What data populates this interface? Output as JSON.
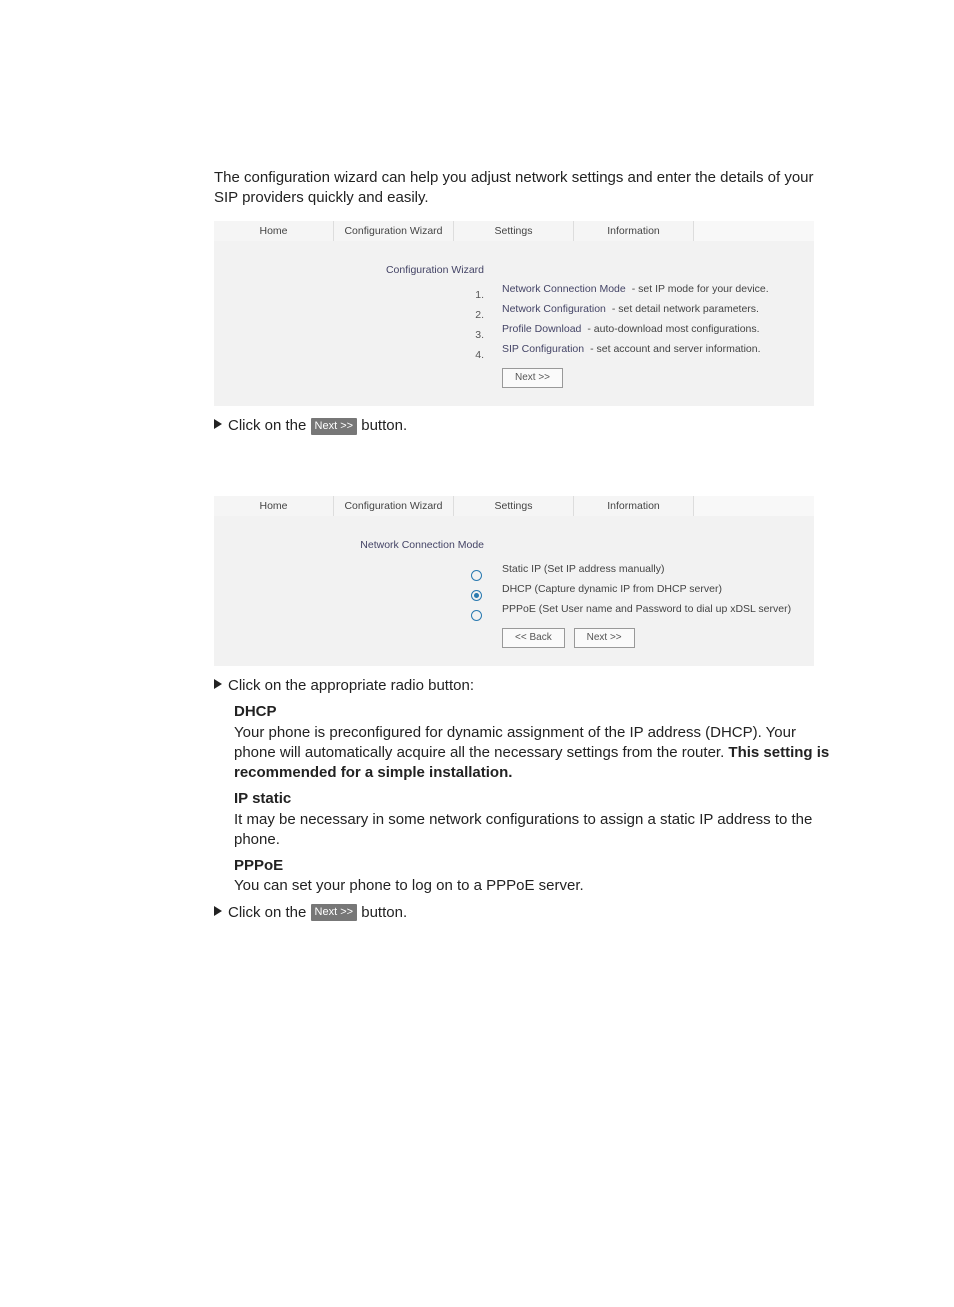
{
  "intro": "The configuration wizard can help you adjust network settings and enter the details of your SIP providers quickly and easily.",
  "tabs": {
    "home": "Home",
    "wizard": "Configuration Wizard",
    "settings": "Settings",
    "information": "Information"
  },
  "shot1": {
    "heading": "Configuration Wizard",
    "items": [
      {
        "n": "1.",
        "title": "Network Connection Mode",
        "desc": " - set IP mode for your device."
      },
      {
        "n": "2.",
        "title": "Network Configuration",
        "desc": " - set detail network parameters."
      },
      {
        "n": "3.",
        "title": "Profile Download",
        "desc": " - auto-download most configurations."
      },
      {
        "n": "4.",
        "title": "SIP Configuration",
        "desc": " - set account and server information."
      }
    ],
    "next": "Next >>"
  },
  "step1": {
    "pre": "Click on the ",
    "btn": "Next >>",
    "post": " button."
  },
  "shot2": {
    "heading": "Network Connection Mode",
    "options": [
      {
        "sel": false,
        "label": "Static IP (Set IP address manually)"
      },
      {
        "sel": true,
        "label": "DHCP (Capture dynamic IP from DHCP server)"
      },
      {
        "sel": false,
        "label": "PPPoE (Set User name and Password to dial up xDSL server)"
      }
    ],
    "back": "<< Back",
    "next": "Next >>"
  },
  "step2": "Click on the appropriate radio button:",
  "dhcp": {
    "title": "DHCP",
    "body": "Your phone is preconfigured for dynamic assignment of the IP address (DHCP). Your phone will automatically acquire all the necessary settings from the router. ",
    "bold": "This setting is recommended for a simple installation."
  },
  "ipstatic": {
    "title": "IP static",
    "body": "It may be necessary in some network configurations to assign a static IP address to the phone."
  },
  "pppoe": {
    "title": "PPPoE",
    "body": "You can set your phone to log on to a PPPoE server."
  },
  "step3": {
    "pre": "Click on the ",
    "btn": "Next >>",
    "post": " button."
  }
}
